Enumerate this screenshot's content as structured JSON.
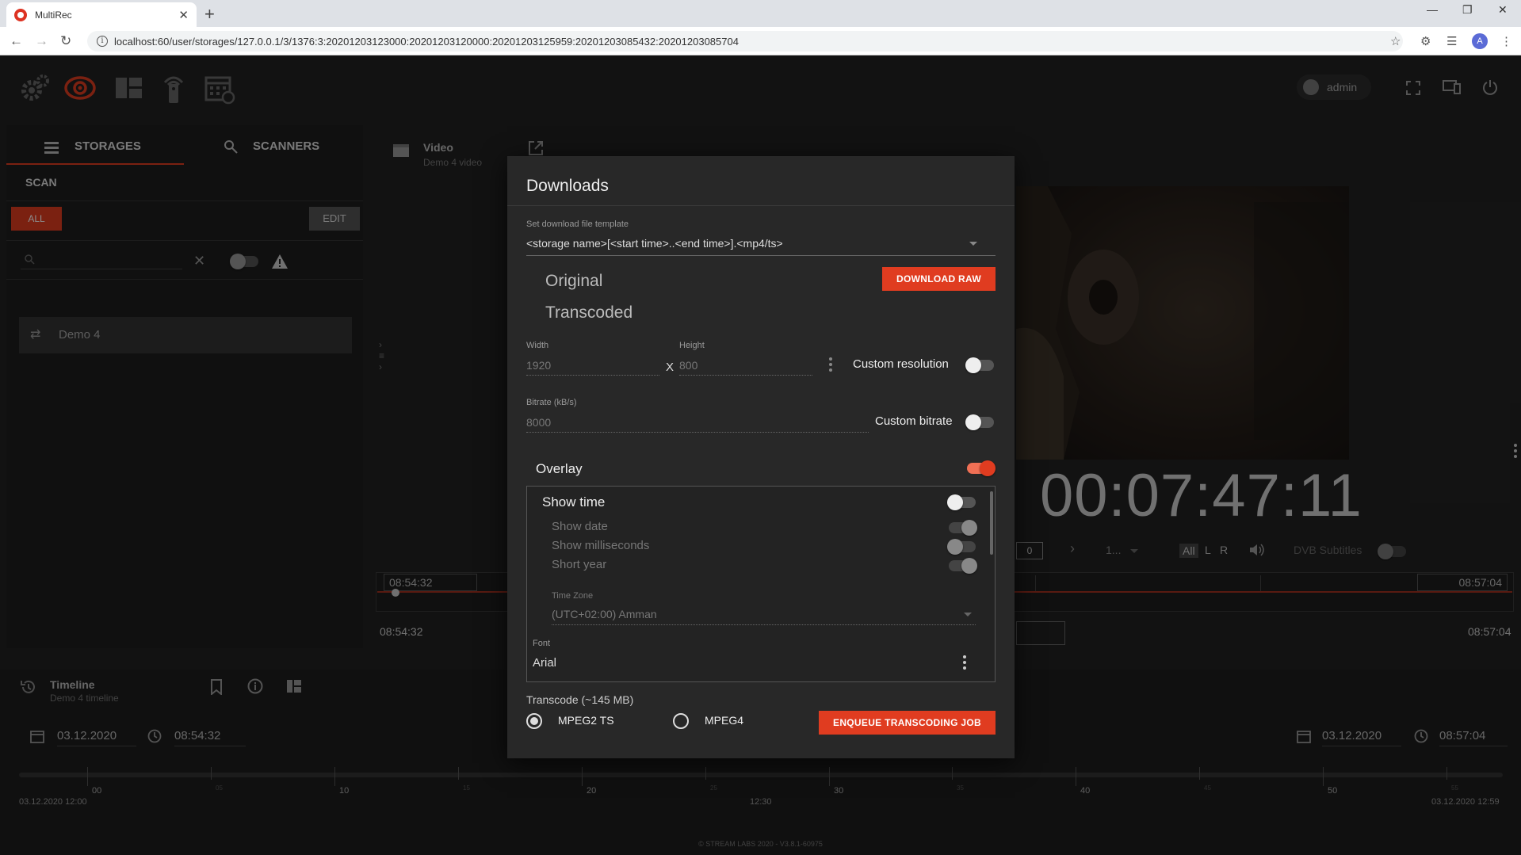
{
  "browser": {
    "tab_title": "MultiRec",
    "tab_close": "✕",
    "new_tab": "+",
    "url": "localhost:60/user/storages/127.0.0.1/3/1376:3:20201203123000:20201203120000:20201203125959:20201203085432:20201203085704",
    "profile_initial": "A"
  },
  "topbar": {
    "user": "admin"
  },
  "sidebar": {
    "tab_storages": "STORAGES",
    "tab_scanners": "SCANNERS",
    "scan": "SCAN",
    "btn_all": "ALL",
    "btn_edit": "EDIT",
    "item": "Demo 4"
  },
  "video": {
    "title": "Video",
    "subtitle": "Demo 4 video",
    "timecode": "00:07:47:11",
    "channel_field": "0",
    "speed_label": "1...",
    "audio_all": "All",
    "audio_l": "L",
    "audio_r": "R",
    "dvb_subtitles": "DVB Subtitles",
    "range_start": "08:54:32",
    "range_end": "08:57:04",
    "below_start": "08:54:32",
    "below_end": "08:57:04"
  },
  "timeline": {
    "title": "Timeline",
    "subtitle": "Demo 4 timeline",
    "start_date": "03.12.2020",
    "start_time": "08:54:32",
    "end_date": "03.12.2020",
    "end_time": "08:57:04",
    "left_edge": "03.12.2020 12:00",
    "center": "12:30",
    "right_edge": "03.12.2020 12:59",
    "major_ticks": [
      "00",
      "10",
      "20",
      "30",
      "40",
      "50"
    ],
    "minor_ticks": [
      "05",
      "15",
      "25",
      "35",
      "45",
      "55"
    ]
  },
  "footer": "© STREAM LABS 2020 - V3.8.1-60975",
  "dialog": {
    "title": "Downloads",
    "template_label": "Set download file template",
    "template_value": "<storage name>[<start time>..<end time>].<mp4/ts>",
    "opt_original": "Original",
    "opt_transcoded": "Transcoded",
    "btn_download_raw": "DOWNLOAD RAW",
    "width_label": "Width",
    "width_value": "1920",
    "x_sep": "X",
    "height_label": "Height",
    "height_value": "800",
    "custom_resolution": "Custom resolution",
    "bitrate_label": "Bitrate (kB/s)",
    "bitrate_value": "8000",
    "custom_bitrate": "Custom bitrate",
    "overlay": "Overlay",
    "overlay_on": true,
    "show_time": "Show time",
    "show_date": "Show date",
    "show_milliseconds": "Show milliseconds",
    "short_year": "Short year",
    "timezone_label": "Time Zone",
    "timezone_value": "(UTC+02:00) Amman",
    "font_label": "Font",
    "font_value": "Arial",
    "transcode_label": "Transcode (~145 MB)",
    "fmt_mpeg2": "MPEG2 TS",
    "fmt_mpeg4": "MPEG4",
    "selected_format": "MPEG2 TS",
    "btn_enqueue": "ENQUEUE TRANSCODING JOB"
  },
  "colors": {
    "accent": "#e03c20",
    "background": "#222222",
    "dialog": "#282828"
  }
}
